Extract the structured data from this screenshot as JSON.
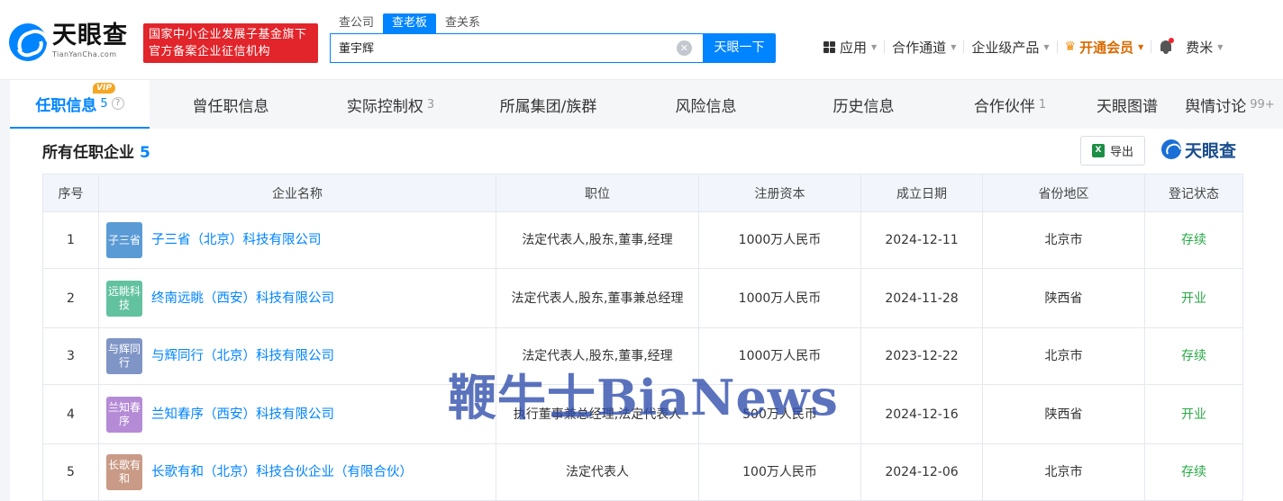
{
  "header": {
    "logo_text": "天眼查",
    "logo_sub": "TianYanCha.com",
    "slogan_line1": "国家中小企业发展子基金旗下",
    "slogan_line2": "官方备案企业征信机构",
    "search_tabs": [
      "查公司",
      "查老板",
      "查关系"
    ],
    "search_value": "董宇辉",
    "search_button": "天眼一下",
    "nav": {
      "apps": "应用",
      "partner": "合作通道",
      "enterprise": "企业级产品",
      "vip": "开通会员",
      "user": "费米"
    }
  },
  "tabs": [
    {
      "label": "任职信息",
      "count": "5",
      "badge": "VIP"
    },
    {
      "label": "曾任职信息",
      "count": ""
    },
    {
      "label": "实际控制权",
      "count": "3"
    },
    {
      "label": "所属集团/族群",
      "count": ""
    },
    {
      "label": "风险信息",
      "count": ""
    },
    {
      "label": "历史信息",
      "count": ""
    },
    {
      "label": "合作伙伴",
      "count": "1"
    },
    {
      "label": "天眼图谱",
      "count": ""
    },
    {
      "label": "舆情讨论",
      "count": "99+"
    }
  ],
  "section": {
    "title": "所有任职企业",
    "count": "5",
    "export": "导出",
    "brand": "天眼查"
  },
  "table": {
    "headers": [
      "序号",
      "企业名称",
      "职位",
      "注册资本",
      "成立日期",
      "省份地区",
      "登记状态"
    ],
    "rows": [
      {
        "no": "1",
        "logo": "子三省",
        "logo_color": "#5b9bd5",
        "name": "子三省（北京）科技有限公司",
        "position": "法定代表人,股东,董事,经理",
        "capital": "1000万人民币",
        "date": "2024-12-11",
        "region": "北京市",
        "status": "存续"
      },
      {
        "no": "2",
        "logo": "远眺科技",
        "logo_color": "#62c2a0",
        "name": "终南远眺（西安）科技有限公司",
        "position": "法定代表人,股东,董事兼总经理",
        "capital": "1000万人民币",
        "date": "2024-11-28",
        "region": "陕西省",
        "status": "开业"
      },
      {
        "no": "3",
        "logo": "与辉同行",
        "logo_color": "#7f95c6",
        "name": "与辉同行（北京）科技有限公司",
        "position": "法定代表人,股东,董事,经理",
        "capital": "1000万人民币",
        "date": "2023-12-22",
        "region": "北京市",
        "status": "存续"
      },
      {
        "no": "4",
        "logo": "兰知春序",
        "logo_color": "#b58bd6",
        "name": "兰知春序（西安）科技有限公司",
        "position": "执行董事兼总经理,法定代表人",
        "capital": "500万人民币",
        "date": "2024-12-16",
        "region": "陕西省",
        "status": "开业"
      },
      {
        "no": "5",
        "logo": "长歌有和",
        "logo_color": "#c99a86",
        "name": "长歌有和（北京）科技合伙企业（有限合伙）",
        "position": "法定代表人",
        "capital": "100万人民币",
        "date": "2024-12-06",
        "region": "北京市",
        "status": "存续"
      }
    ]
  },
  "watermark": "鞭牛士BiaNews"
}
